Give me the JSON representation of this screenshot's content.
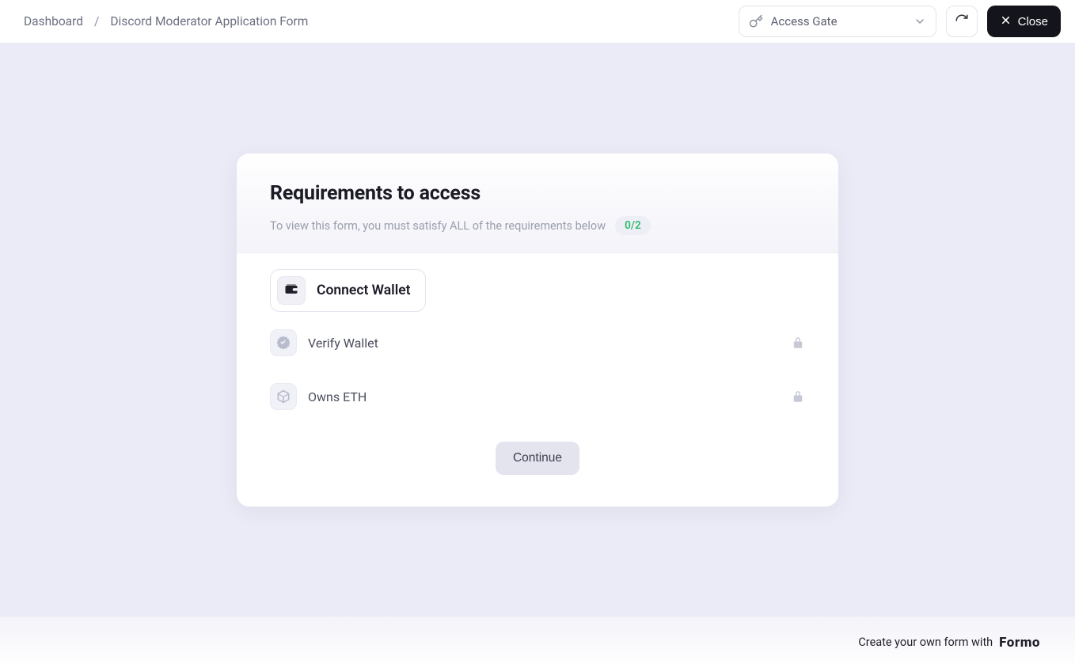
{
  "breadcrumb": {
    "dashboard": "Dashboard",
    "separator": "/",
    "current": "Discord Moderator Application Form"
  },
  "header": {
    "access_gate_label": "Access Gate",
    "close_label": "Close"
  },
  "card": {
    "title": "Requirements to access",
    "subtitle": "To view this form, you must satisfy ALL of the requirements below",
    "progress": "0/2",
    "connect_wallet": "Connect Wallet",
    "requirements": [
      {
        "label": "Verify Wallet"
      },
      {
        "label": "Owns ETH"
      }
    ],
    "continue": "Continue"
  },
  "footer": {
    "text": "Create your own form with",
    "brand": "Formo"
  }
}
